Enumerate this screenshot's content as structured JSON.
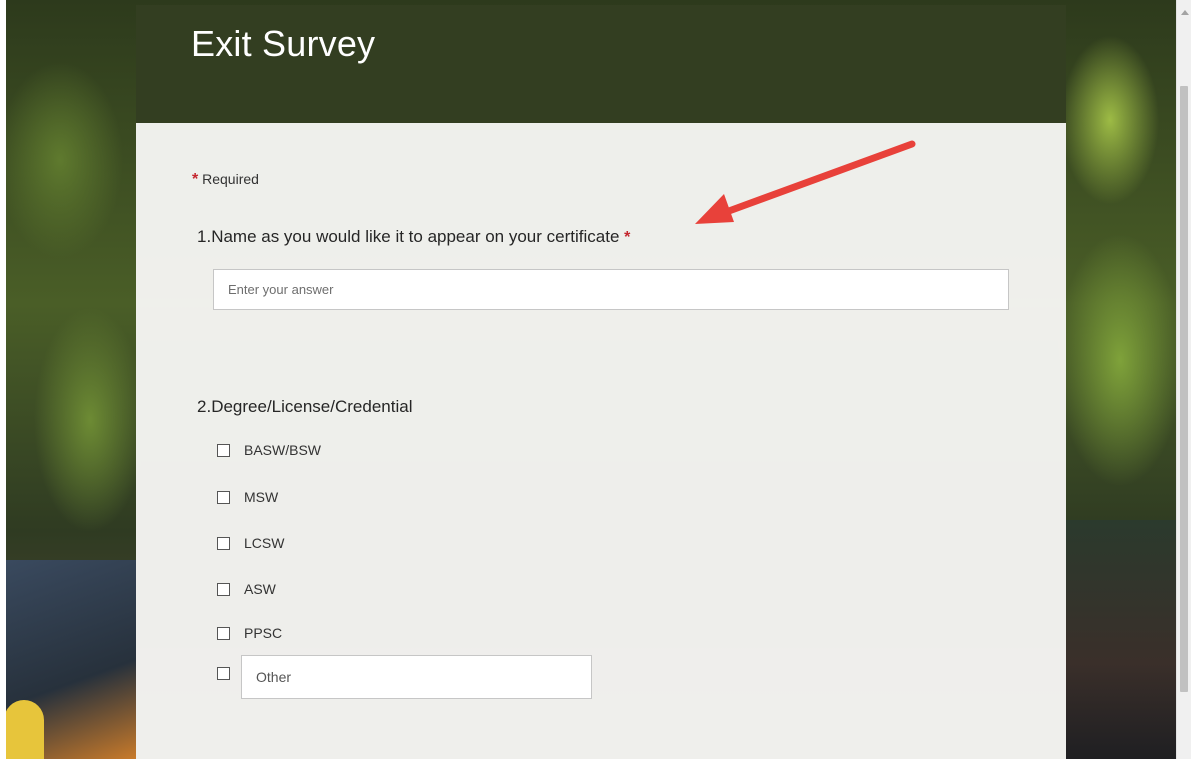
{
  "survey": {
    "title": "Exit Survey",
    "required_label": "Required",
    "required_marker": "*"
  },
  "questions": [
    {
      "number": "1.",
      "text": "Name as you would like it to appear on your certificate",
      "required": true,
      "placeholder": "Enter your answer"
    },
    {
      "number": "2.",
      "text": "Degree/License/Credential",
      "required": false,
      "options": [
        "BASW/BSW",
        "MSW",
        "LCSW",
        "ASW",
        "PPSC"
      ],
      "other_placeholder": "Other"
    }
  ],
  "colors": {
    "header_bg": "#333e21",
    "required_red": "#c4262e",
    "annotation_arrow": "#e8413a"
  }
}
